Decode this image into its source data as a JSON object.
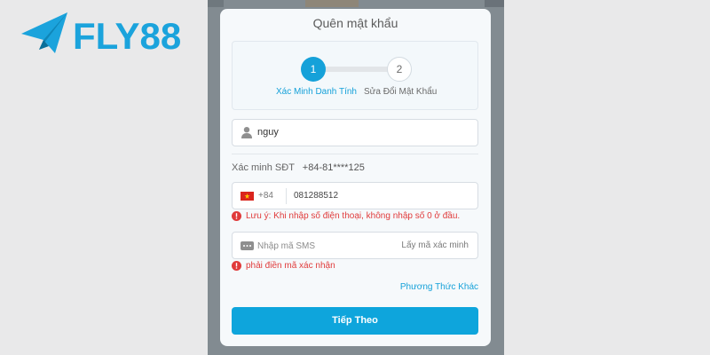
{
  "brand": {
    "name": "FLY88",
    "color": "#1ba3dc",
    "icon": "paper-plane-icon"
  },
  "modal": {
    "title": "Quên mật khẩu",
    "steps": [
      {
        "number": "1",
        "label": "Xác Minh Danh Tính",
        "active": true
      },
      {
        "number": "2",
        "label": "Sửa Đổi Mật Khẩu",
        "active": false
      }
    ],
    "username": {
      "value": "nguy",
      "icon": "user-icon"
    },
    "verify": {
      "label": "Xác minh SĐT",
      "number": "+84-81****125"
    },
    "phone": {
      "country_code": "+84",
      "value": "081288512",
      "flag": "vietnam-flag-icon"
    },
    "phone_error": "Lưu ý: Khi nhập số điện thoại, không nhập số 0 ở đầu.",
    "sms": {
      "placeholder": "Nhập mã SMS",
      "get_code": "Lấy mã xác minh",
      "icon": "message-icon"
    },
    "sms_error": "phải điền mã xác nhận",
    "other_method": "Phương Thức Khác",
    "next_button": "Tiếp Theo"
  },
  "colors": {
    "accent": "#0ea5dc",
    "error": "#e03b3b",
    "overlay": "#828b91"
  }
}
